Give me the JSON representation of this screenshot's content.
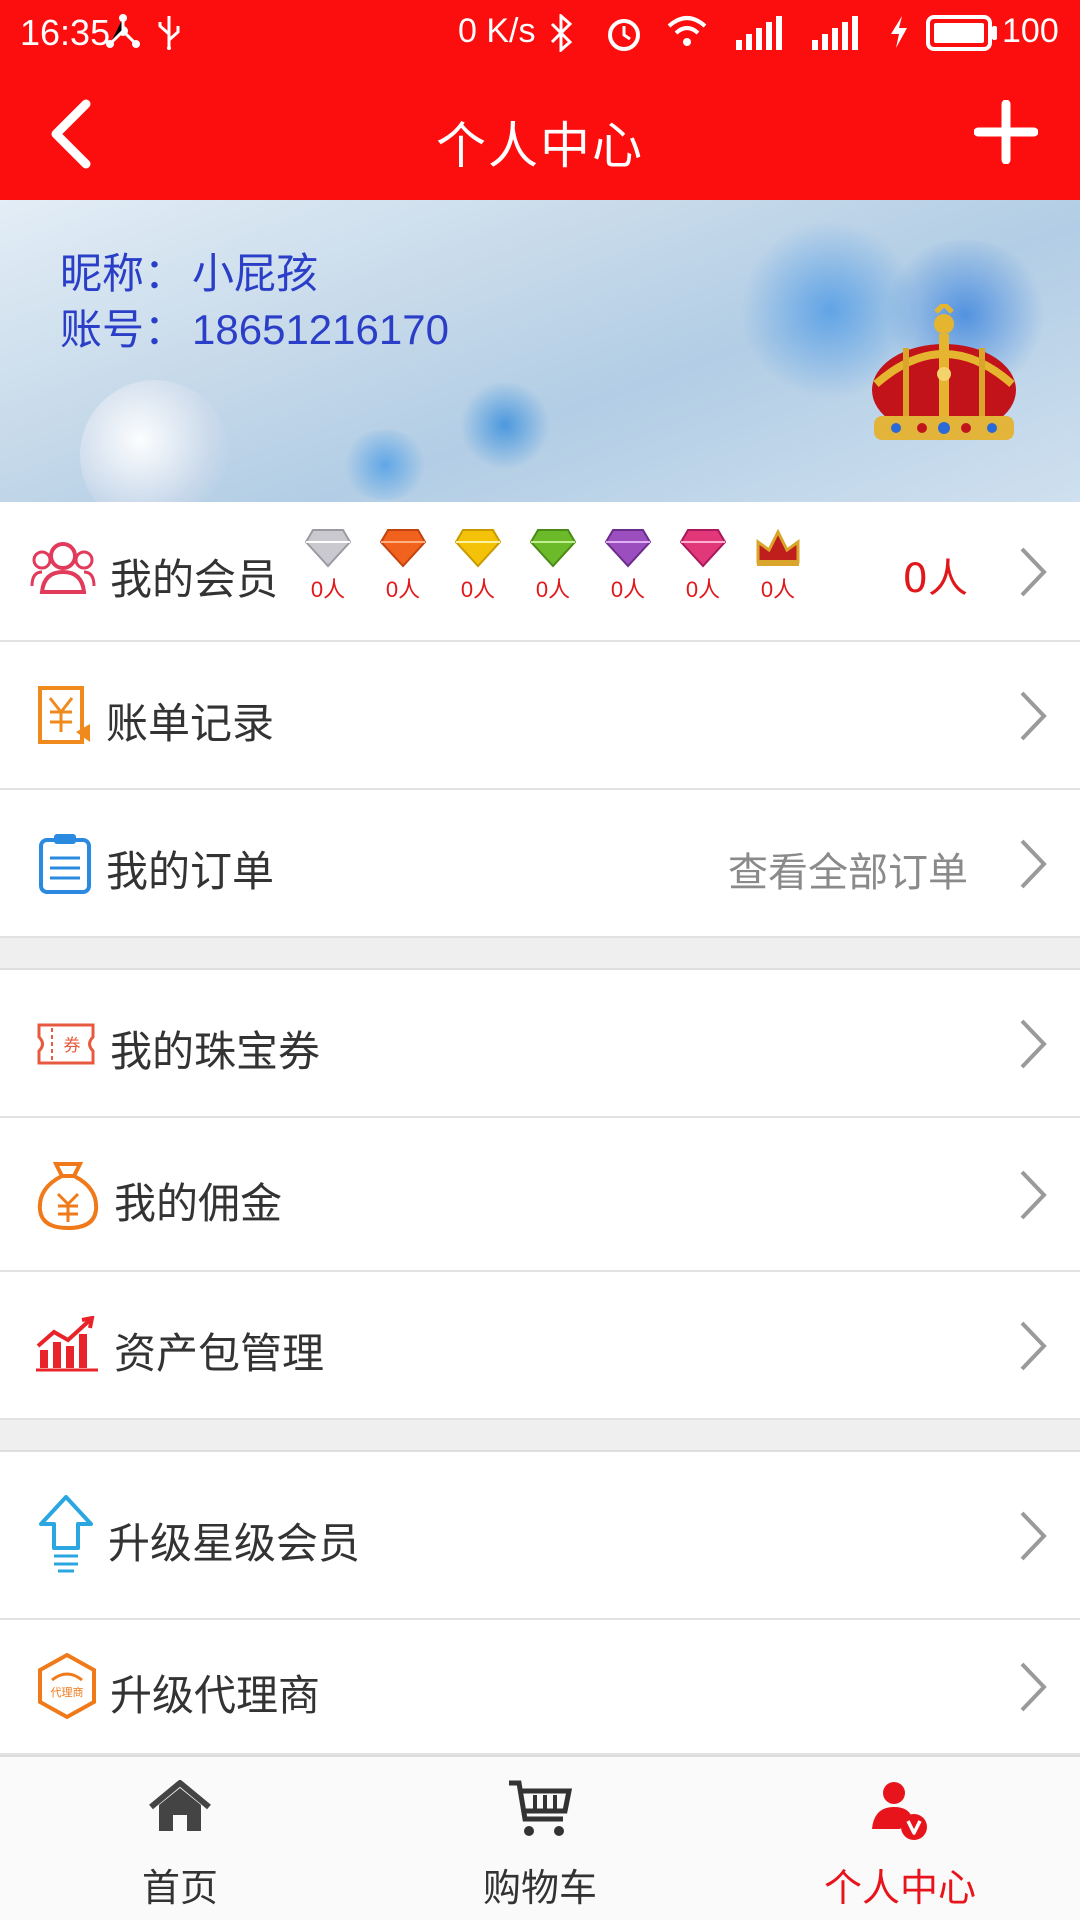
{
  "status_bar": {
    "time": "16:35",
    "net_speed": "0 K/s",
    "battery": "100"
  },
  "header": {
    "title": "个人中心",
    "back_icon": "chevron-left-icon",
    "add_icon": "plus-icon"
  },
  "profile": {
    "nickname_label": "昵称：",
    "nickname": "小屁孩",
    "account_label": "账号：",
    "account": "18651216170"
  },
  "members": {
    "label": "我的会员",
    "levels": [
      {
        "icon": "diamond-silver-icon",
        "count": "0人",
        "color": "#c9c9cf"
      },
      {
        "icon": "diamond-orange-icon",
        "count": "0人",
        "color": "#f0621e"
      },
      {
        "icon": "diamond-yellow-icon",
        "count": "0人",
        "color": "#f5c20a"
      },
      {
        "icon": "diamond-green-icon",
        "count": "0人",
        "color": "#6cba2a"
      },
      {
        "icon": "diamond-purple-icon",
        "count": "0人",
        "color": "#9b4fbf"
      },
      {
        "icon": "diamond-pink-icon",
        "count": "0人",
        "color": "#e2387a"
      },
      {
        "icon": "crown-icon",
        "count": "0人",
        "color": "#c01d1d"
      }
    ],
    "total": "0人"
  },
  "menu": {
    "bills": "账单记录",
    "orders": "我的订单",
    "orders_all": "查看全部订单",
    "coupons": "我的珠宝券",
    "commission": "我的佣金",
    "assets": "资产包管理",
    "upgrade_star": "升级星级会员",
    "upgrade_agent": "升级代理商",
    "agent_badge": "代理商",
    "coupon_badge": "券"
  },
  "tabs": [
    {
      "label": "首页",
      "icon": "home-icon",
      "active": false
    },
    {
      "label": "购物车",
      "icon": "cart-icon",
      "active": false
    },
    {
      "label": "个人中心",
      "icon": "user-vip-icon",
      "active": true
    }
  ],
  "colors": {
    "brand_red": "#fc0d0e",
    "profile_blue": "#2a3ec8",
    "active_tab": "#e8141b"
  }
}
